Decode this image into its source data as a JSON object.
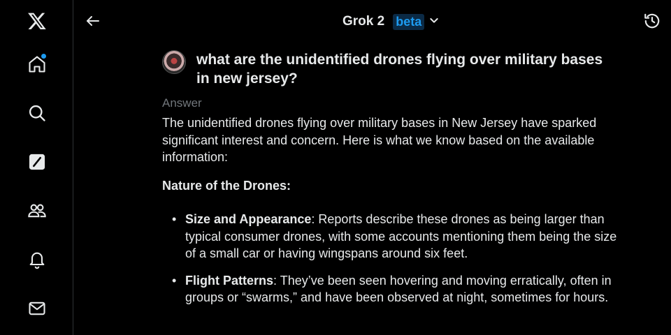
{
  "sidebar": {
    "items": [
      {
        "name": "x-logo",
        "icon": "x-logo-icon"
      },
      {
        "name": "home",
        "icon": "home-icon",
        "has_dot": true
      },
      {
        "name": "search",
        "icon": "search-icon"
      },
      {
        "name": "grok",
        "icon": "grok-icon"
      },
      {
        "name": "communities",
        "icon": "communities-icon"
      },
      {
        "name": "notifications",
        "icon": "bell-icon"
      },
      {
        "name": "messages",
        "icon": "mail-icon"
      }
    ],
    "dot_color": "#1d9bf0"
  },
  "header": {
    "title": "Grok 2",
    "badge": "beta",
    "back_icon": "arrow-left-icon",
    "dropdown_icon": "chevron-down-icon",
    "history_icon": "history-icon"
  },
  "conversation": {
    "question": "what are the unidentified drones flying over military bases in new jersey?",
    "answer_label": "Answer",
    "answer_intro": "The unidentified drones flying over military bases in New Jersey have sparked significant interest and concern. Here is what we know based on the available information:",
    "section_heading": "Nature of the Drones:",
    "bullets": [
      {
        "term": "Size and Appearance",
        "text": ": Reports describe these drones as being larger than typical consumer drones, with some accounts mentioning them being the size of a small car or having wingspans around six feet."
      },
      {
        "term": "Flight Patterns",
        "text": ": They’ve been seen hovering and moving erratically, often in groups or “swarms,” and have been observed at night, sometimes for hours."
      }
    ]
  },
  "colors": {
    "background": "#000000",
    "text": "#e7e9ea",
    "muted": "#71767b",
    "accent": "#1d9bf0",
    "divider": "#2f3336"
  }
}
